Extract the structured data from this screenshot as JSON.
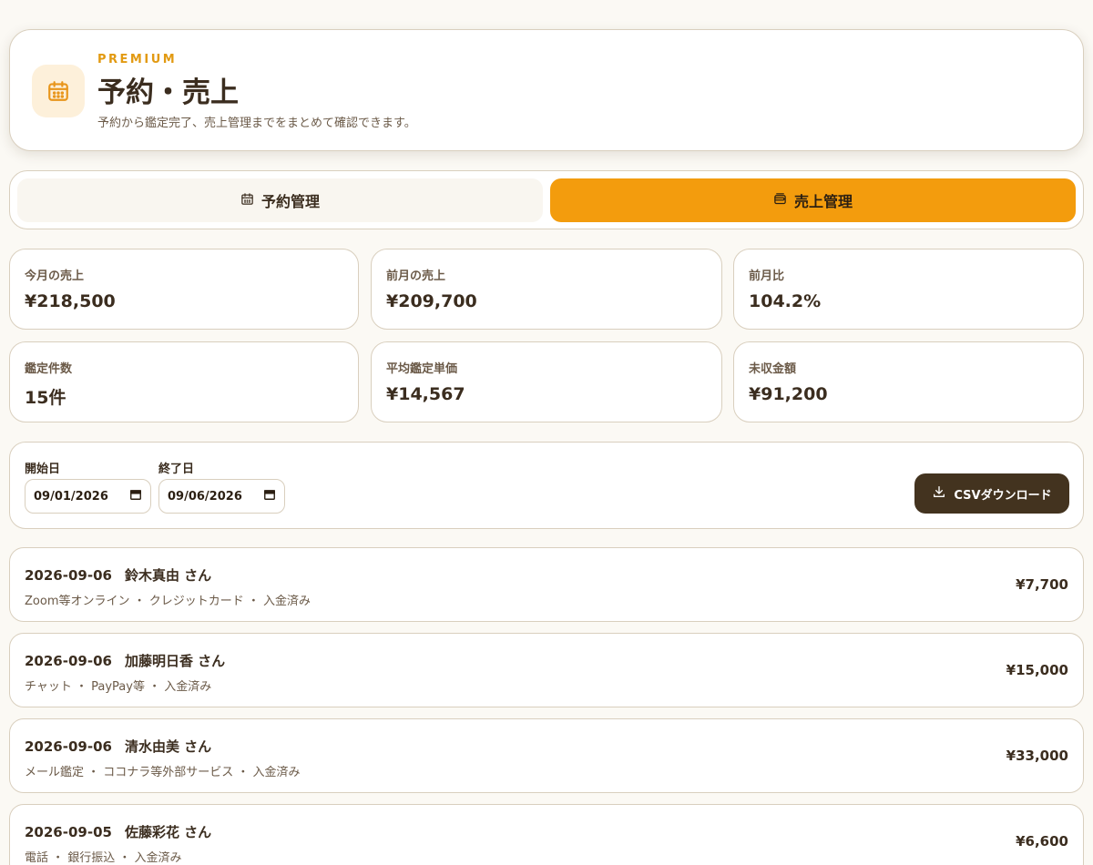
{
  "header": {
    "eyebrow": "PREMIUM",
    "title": "予約・売上",
    "description": "予約から鑑定完了、売上管理までをまとめて確認できます。",
    "icon": "calendar-icon",
    "accent_color": "#f39c0d"
  },
  "tabs": [
    {
      "label": "予約管理",
      "icon": "calendar-icon",
      "active": false
    },
    {
      "label": "売上管理",
      "icon": "wallet-icon",
      "active": true
    }
  ],
  "stats": [
    {
      "label": "今月の売上",
      "value": "¥218,500"
    },
    {
      "label": "前月の売上",
      "value": "¥209,700"
    },
    {
      "label": "前月比",
      "value": "104.2%"
    },
    {
      "label": "鑑定件数",
      "value": "15件"
    },
    {
      "label": "平均鑑定単価",
      "value": "¥14,567"
    },
    {
      "label": "未収金額",
      "value": "¥91,200"
    }
  ],
  "filter": {
    "start_label": "開始日",
    "start_value": "09/01/2026",
    "end_label": "終了日",
    "end_value": "09/06/2026",
    "csv_label": "CSVダウンロード"
  },
  "sales": [
    {
      "date": "2026-09-06",
      "name": "鈴木真由 さん",
      "meta": "Zoom等オンライン ・ クレジットカード ・ 入金済み",
      "amount": "¥7,700"
    },
    {
      "date": "2026-09-06",
      "name": "加藤明日香 さん",
      "meta": "チャット ・ PayPay等 ・ 入金済み",
      "amount": "¥15,000"
    },
    {
      "date": "2026-09-06",
      "name": "清水由美 さん",
      "meta": "メール鑑定 ・ ココナラ等外部サービス ・ 入金済み",
      "amount": "¥33,000"
    },
    {
      "date": "2026-09-05",
      "name": "佐藤彩花 さん",
      "meta": "電話 ・ 銀行振込 ・ 入金済み",
      "amount": "¥6,600"
    }
  ]
}
